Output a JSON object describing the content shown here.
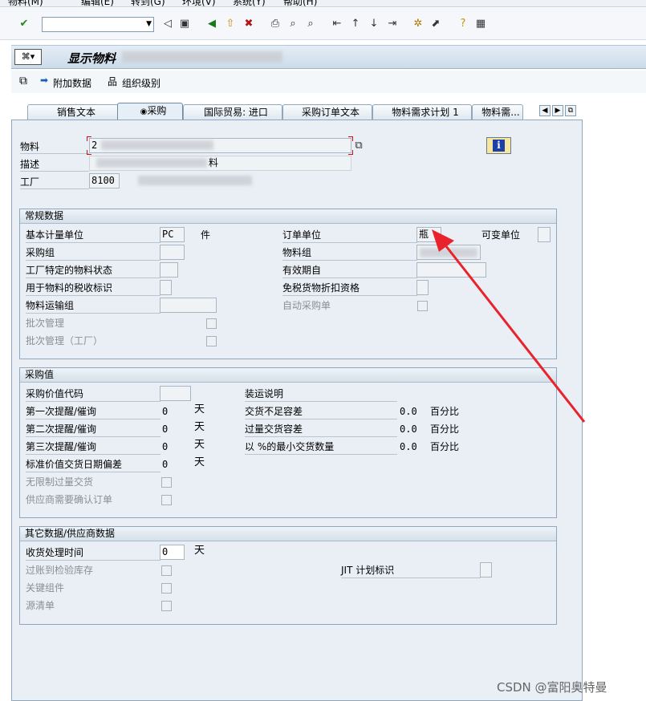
{
  "menubar": {
    "items": [
      "物料(M)",
      "编辑(E)",
      "转到(G)",
      "环境(V)",
      "系统(Y)",
      "帮助(H)"
    ]
  },
  "toolbar": {
    "icons": [
      "check-icon",
      "back-icon",
      "save-icon",
      "green-back-icon",
      "exit-icon",
      "cancel-icon",
      "print-icon",
      "find-icon",
      "find-next-icon",
      "first-page-icon",
      "prev-page-icon",
      "next-page-icon",
      "last-page-icon",
      "new-session-icon",
      "shortcut-icon",
      "help-icon",
      "layout-icon"
    ]
  },
  "title": {
    "text": "显示物料"
  },
  "app_toolbar": {
    "additional_data": "附加数据",
    "org_levels": "组织级别"
  },
  "tabs": [
    {
      "label": "销售文本"
    },
    {
      "label": "采购"
    },
    {
      "label": "国际贸易: 进口"
    },
    {
      "label": "采购订单文本"
    },
    {
      "label": "物料需求计划 1"
    },
    {
      "label": "物料需..."
    }
  ],
  "header": {
    "material_label": "物料",
    "material_value": "2",
    "desc_label": "描述",
    "desc_value": "料",
    "plant_label": "工厂",
    "plant_value": "8100"
  },
  "general": {
    "title": "常规数据",
    "base_uom_label": "基本计量单位",
    "base_uom_value": "PC",
    "base_uom_text": "件",
    "order_unit_label": "订单单位",
    "order_unit_value": "瓶",
    "var_unit_label": "可变单位",
    "pur_group_label": "采购组",
    "mat_group_label": "物料组",
    "plant_status_label": "工厂特定的物料状态",
    "valid_from_label": "有效期自",
    "tax_label": "用于物料的税收标识",
    "discount_label": "免税货物折扣资格",
    "freight_label": "物料运输组",
    "auto_po_label": "自动采购单",
    "batch_label": "批次管理",
    "batch_plant_label": "批次管理（工厂）"
  },
  "purchasing": {
    "title": "采购值",
    "value_key_label": "采购价值代码",
    "reminder1_label": "第一次提醒/催询",
    "reminder1_value": "0",
    "reminder2_label": "第二次提醒/催询",
    "reminder2_value": "0",
    "reminder3_label": "第三次提醒/催询",
    "reminder3_value": "0",
    "std_dev_label": "标准价值交货日期偏差",
    "std_dev_value": "0",
    "day_unit": "天",
    "unlimited_label": "无限制过量交货",
    "vendor_ack_label": "供应商需要确认订单",
    "shipping_label": "装运说明",
    "under_label": "交货不足容差",
    "under_value": "0.0",
    "over_label": "过量交货容差",
    "over_value": "0.0",
    "min_label": "以 %的最小交货数量",
    "min_value": "0.0",
    "percent_unit": "百分比"
  },
  "other": {
    "title": "其它数据/供应商数据",
    "gr_time_label": "收货处理时间",
    "gr_time_value": "0",
    "day_unit": "天",
    "post_insp_label": "过账到检验库存",
    "critical_label": "关键组件",
    "source_list_label": "源清单",
    "jit_label": "JIT 计划标识"
  },
  "watermark": "CSDN @富阳奥特曼",
  "colors": {
    "annotation_arrow": "#e8232b",
    "panel_bg": "#e9eff5"
  }
}
